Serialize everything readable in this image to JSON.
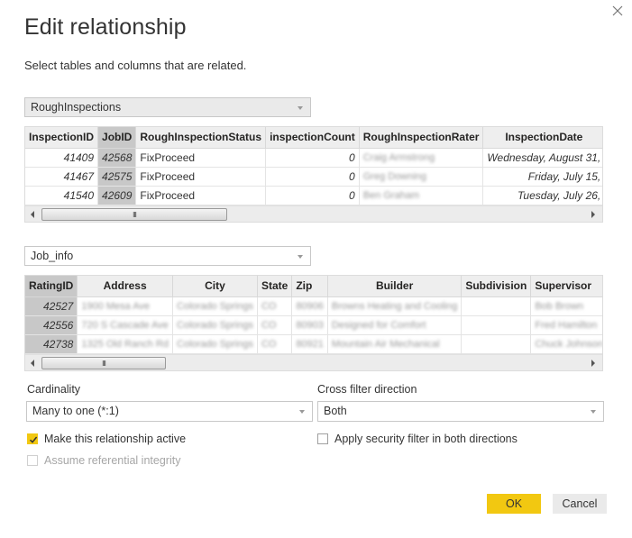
{
  "dialog": {
    "title": "Edit relationship",
    "subtitle": "Select tables and columns that are related.",
    "close_icon": "close-icon"
  },
  "table1": {
    "selected_table": "RoughInspections",
    "columns": [
      "InspectionID",
      "JobID",
      "RoughInspectionStatus",
      "inspectionCount",
      "RoughInspectionRater",
      "InspectionDate"
    ],
    "selected_column": "JobID",
    "rows": [
      [
        "41409",
        "42568",
        "FixProceed",
        "0",
        "Craig Armstrong",
        "Wednesday, August 31,"
      ],
      [
        "41467",
        "42575",
        "FixProceed",
        "0",
        "Greg Downing",
        "Friday, July 15,"
      ],
      [
        "41540",
        "42609",
        "FixProceed",
        "0",
        "Ben Graham",
        "Tuesday, July 26,"
      ]
    ],
    "scroll_grip": "III"
  },
  "table2": {
    "selected_table": "Job_info",
    "columns": [
      "RatingID",
      "Address",
      "City",
      "State",
      "Zip",
      "Builder",
      "Subdivision",
      "Supervisor"
    ],
    "selected_column": "RatingID",
    "rows": [
      [
        "42527",
        "1900 Mesa Ave",
        "Colorado Springs",
        "CO",
        "80906",
        "Browns Heating and Cooling",
        "",
        "Bob Brown"
      ],
      [
        "42556",
        "720 S Cascade Ave",
        "Colorado Springs",
        "CO",
        "80903",
        "Designed for Comfort",
        "",
        "Fred Hamilton"
      ],
      [
        "42738",
        "1325 Old Ranch Rd",
        "Colorado Springs",
        "CO",
        "80921",
        "Mountain Air Mechanical",
        "",
        "Chuck Johnson"
      ]
    ],
    "scroll_grip": "III"
  },
  "cardinality": {
    "label": "Cardinality",
    "value": "Many to one (*:1)"
  },
  "cross_filter": {
    "label": "Cross filter direction",
    "value": "Both"
  },
  "options": {
    "make_active": {
      "label": "Make this relationship active",
      "checked": true
    },
    "security_filter": {
      "label": "Apply security filter in both directions",
      "checked": false
    },
    "referential_integrity": {
      "label": "Assume referential integrity",
      "checked": false,
      "disabled": true
    }
  },
  "buttons": {
    "ok": "OK",
    "cancel": "Cancel"
  },
  "colors": {
    "accent": "#f2c811",
    "selected_column_bg": "#c8c8c8"
  }
}
